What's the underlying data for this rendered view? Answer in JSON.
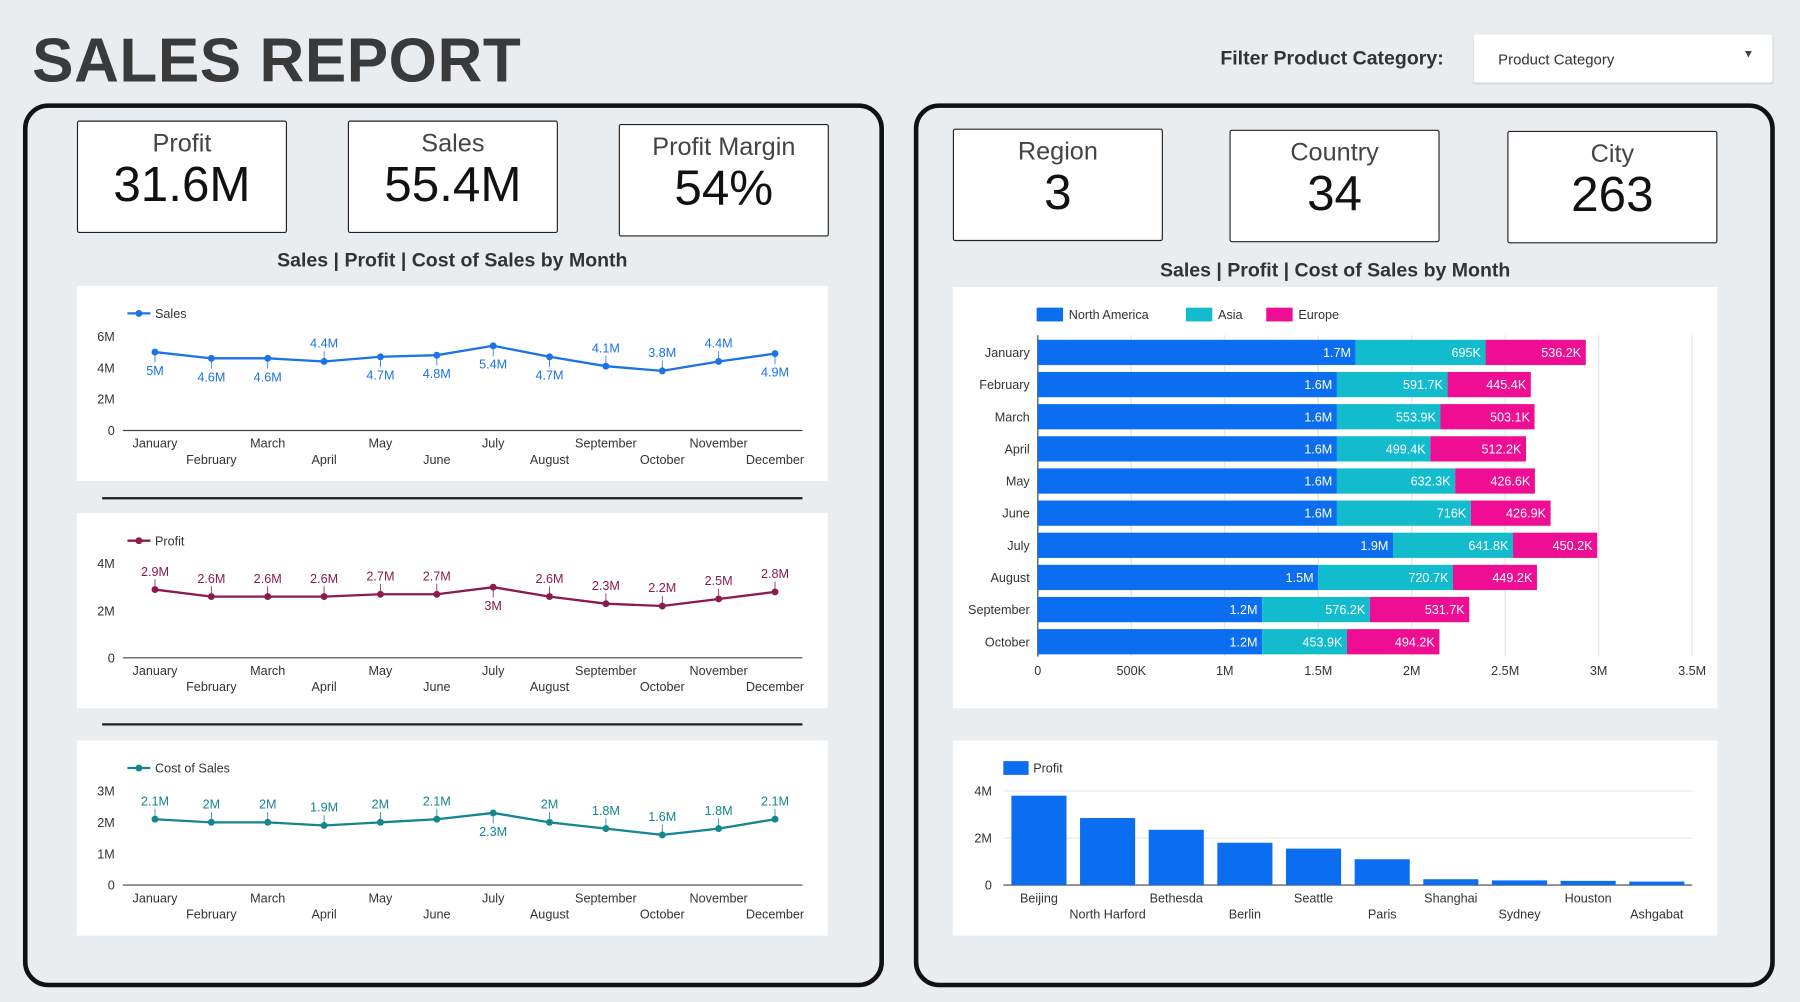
{
  "header": {
    "title": "SALES REPORT",
    "filter_label": "Filter Product Category:",
    "filter_value": "Product Category"
  },
  "kpis_left": [
    {
      "label": "Profit",
      "value": "31.6M"
    },
    {
      "label": "Sales",
      "value": "55.4M"
    },
    {
      "label": "Profit Margin",
      "value": "54%"
    }
  ],
  "kpis_right": [
    {
      "label": "Region",
      "value": "3"
    },
    {
      "label": "Country",
      "value": "34"
    },
    {
      "label": "City",
      "value": "263"
    }
  ],
  "left_section_title": "Sales | Profit | Cost of Sales by Month",
  "right_section_title": "Sales | Profit | Cost of Sales by Month",
  "colors": {
    "sales": "#1a73e8",
    "profit": "#8b1a4f",
    "cost": "#13868e",
    "na": "#0b6ef0",
    "asia": "#12bccc",
    "europe": "#ef0e93"
  },
  "chart_data": [
    {
      "type": "line",
      "series": [
        {
          "name": "Sales",
          "values": [
            5.0,
            4.6,
            4.6,
            4.4,
            4.7,
            4.8,
            5.4,
            4.7,
            4.1,
            3.8,
            4.4,
            4.9
          ]
        }
      ],
      "x": [
        "January",
        "February",
        "March",
        "April",
        "May",
        "June",
        "July",
        "August",
        "September",
        "October",
        "November",
        "December"
      ],
      "data_labels": [
        "5M",
        "4.6M",
        "4.6M",
        "4.4M",
        "4.7M",
        "4.8M",
        "5.4M",
        "4.7M",
        "4.1M",
        "3.8M",
        "4.4M",
        "4.9M"
      ],
      "ylim": [
        0,
        6
      ],
      "yticks": [
        "0",
        "2M",
        "4M",
        "6M"
      ]
    },
    {
      "type": "line",
      "series": [
        {
          "name": "Profit",
          "values": [
            2.9,
            2.6,
            2.6,
            2.6,
            2.7,
            2.7,
            3.0,
            2.6,
            2.3,
            2.2,
            2.5,
            2.8
          ]
        }
      ],
      "x": [
        "January",
        "February",
        "March",
        "April",
        "May",
        "June",
        "July",
        "August",
        "September",
        "October",
        "November",
        "December"
      ],
      "data_labels": [
        "2.9M",
        "2.6M",
        "2.6M",
        "2.6M",
        "2.7M",
        "2.7M",
        "3M",
        "2.6M",
        "2.3M",
        "2.2M",
        "2.5M",
        "2.8M"
      ],
      "ylim": [
        0,
        4
      ],
      "yticks": [
        "0",
        "2M",
        "4M"
      ]
    },
    {
      "type": "line",
      "series": [
        {
          "name": "Cost of Sales",
          "values": [
            2.1,
            2.0,
            2.0,
            1.9,
            2.0,
            2.1,
            2.3,
            2.0,
            1.8,
            1.6,
            1.8,
            2.1
          ]
        }
      ],
      "x": [
        "January",
        "February",
        "March",
        "April",
        "May",
        "June",
        "July",
        "August",
        "September",
        "October",
        "November",
        "December"
      ],
      "data_labels": [
        "2.1M",
        "2M",
        "2M",
        "1.9M",
        "2M",
        "2.1M",
        "2.3M",
        "2M",
        "1.8M",
        "1.6M",
        "1.8M",
        "2.1M"
      ],
      "ylim": [
        0,
        3
      ],
      "yticks": [
        "0",
        "1M",
        "2M",
        "3M"
      ]
    },
    {
      "type": "bar",
      "orientation": "horizontal",
      "stacked": true,
      "categories": [
        "January",
        "February",
        "March",
        "April",
        "May",
        "June",
        "July",
        "August",
        "September",
        "October"
      ],
      "series": [
        {
          "name": "North America",
          "values": [
            1.7,
            1.6,
            1.6,
            1.6,
            1.6,
            1.6,
            1.9,
            1.5,
            1.2,
            1.2
          ],
          "labels": [
            "1.7M",
            "1.6M",
            "1.6M",
            "1.6M",
            "1.6M",
            "1.6M",
            "1.9M",
            "1.5M",
            "1.2M",
            "1.2M"
          ]
        },
        {
          "name": "Asia",
          "values": [
            0.695,
            0.5917,
            0.5539,
            0.4994,
            0.6323,
            0.716,
            0.6418,
            0.7207,
            0.5762,
            0.4539
          ],
          "labels": [
            "695K",
            "591.7K",
            "553.9K",
            "499.4K",
            "632.3K",
            "716K",
            "641.8K",
            "720.7K",
            "576.2K",
            "453.9K"
          ]
        },
        {
          "name": "Europe",
          "values": [
            0.5362,
            0.4454,
            0.5031,
            0.5122,
            0.4266,
            0.4269,
            0.4502,
            0.4492,
            0.5317,
            0.4942
          ],
          "labels": [
            "536.2K",
            "445.4K",
            "503.1K",
            "512.2K",
            "426.6K",
            "426.9K",
            "450.2K",
            "449.2K",
            "531.7K",
            "494.2K"
          ]
        }
      ],
      "xlim": [
        0,
        3.5
      ],
      "xticks": [
        "0",
        "500K",
        "1M",
        "1.5M",
        "2M",
        "2.5M",
        "3M",
        "3.5M"
      ],
      "legend": "top-left"
    },
    {
      "type": "bar",
      "series": [
        {
          "name": "Profit",
          "values": [
            3.8,
            2.85,
            2.35,
            1.8,
            1.55,
            1.1,
            0.25,
            0.2,
            0.18,
            0.15
          ]
        }
      ],
      "categories": [
        "Beijing",
        "North Harford",
        "Bethesda",
        "Berlin",
        "Seattle",
        "Paris",
        "Shanghai",
        "Sydney",
        "Houston",
        "Ashgabat"
      ],
      "ylim": [
        0,
        4
      ],
      "yticks": [
        "0",
        "2M",
        "4M"
      ],
      "legend": "top-left"
    }
  ]
}
